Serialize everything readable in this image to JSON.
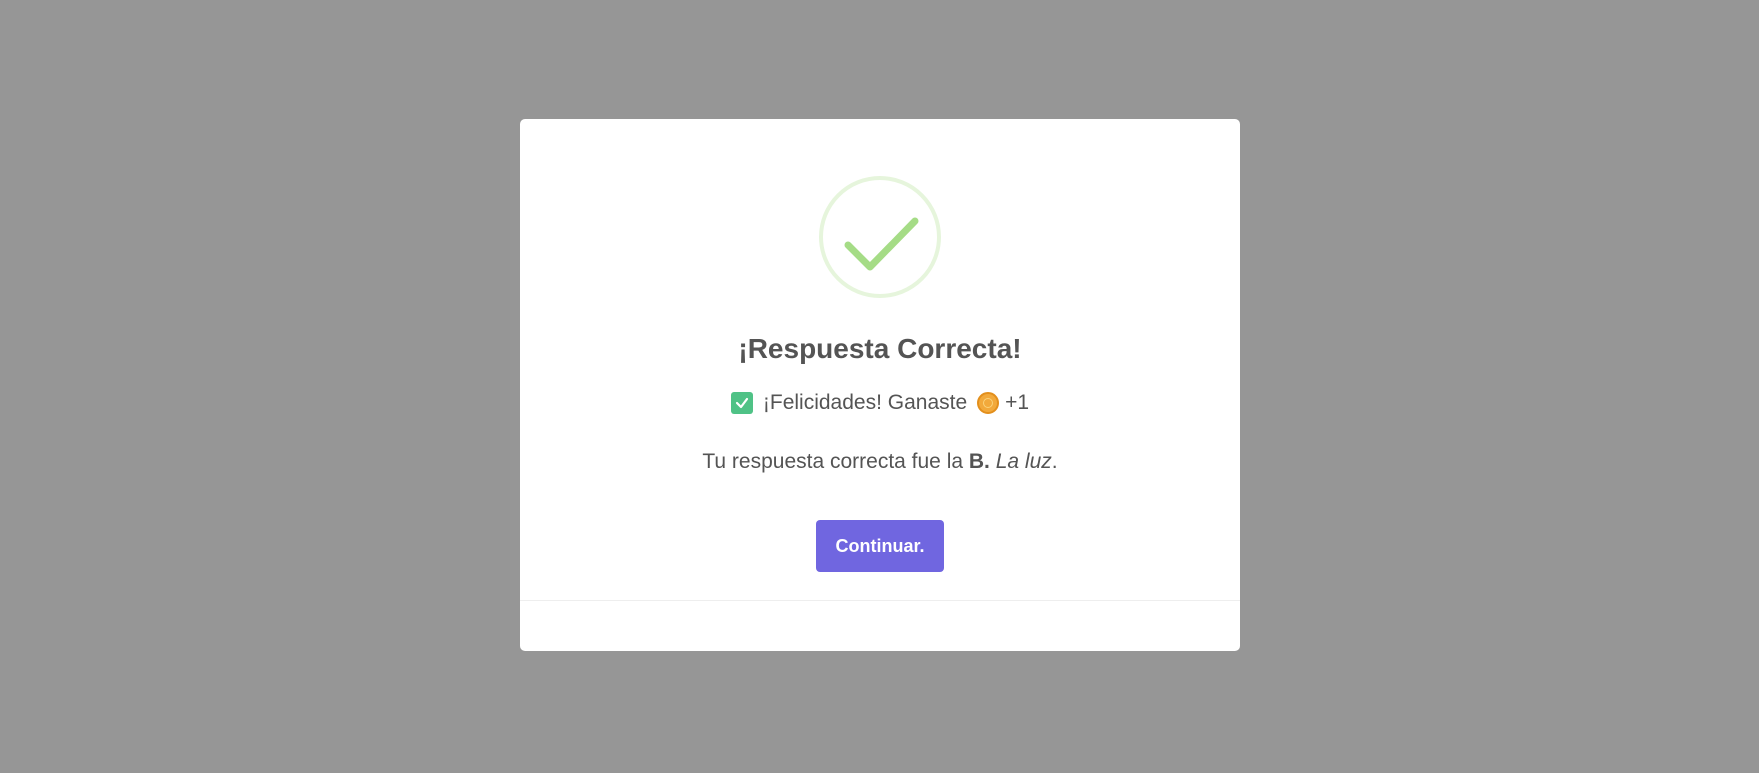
{
  "dialog": {
    "title": "¡Respuesta Correcta!",
    "reward": {
      "check_icon": "check-box-icon",
      "text": "¡Felicidades! Ganaste",
      "coin_icon": "coin-icon",
      "amount": "+1"
    },
    "answer": {
      "prefix": "Tu respuesta correcta fue la",
      "letter": "B.",
      "text": "La luz",
      "suffix": "."
    },
    "continue_label": "Continuar.",
    "success_icon": "success-check-icon"
  },
  "colors": {
    "overlay": "#969696",
    "button": "#7066e0",
    "success_ring": "#e6f5dc",
    "success_check": "#a5dc86",
    "text": "#545454"
  }
}
